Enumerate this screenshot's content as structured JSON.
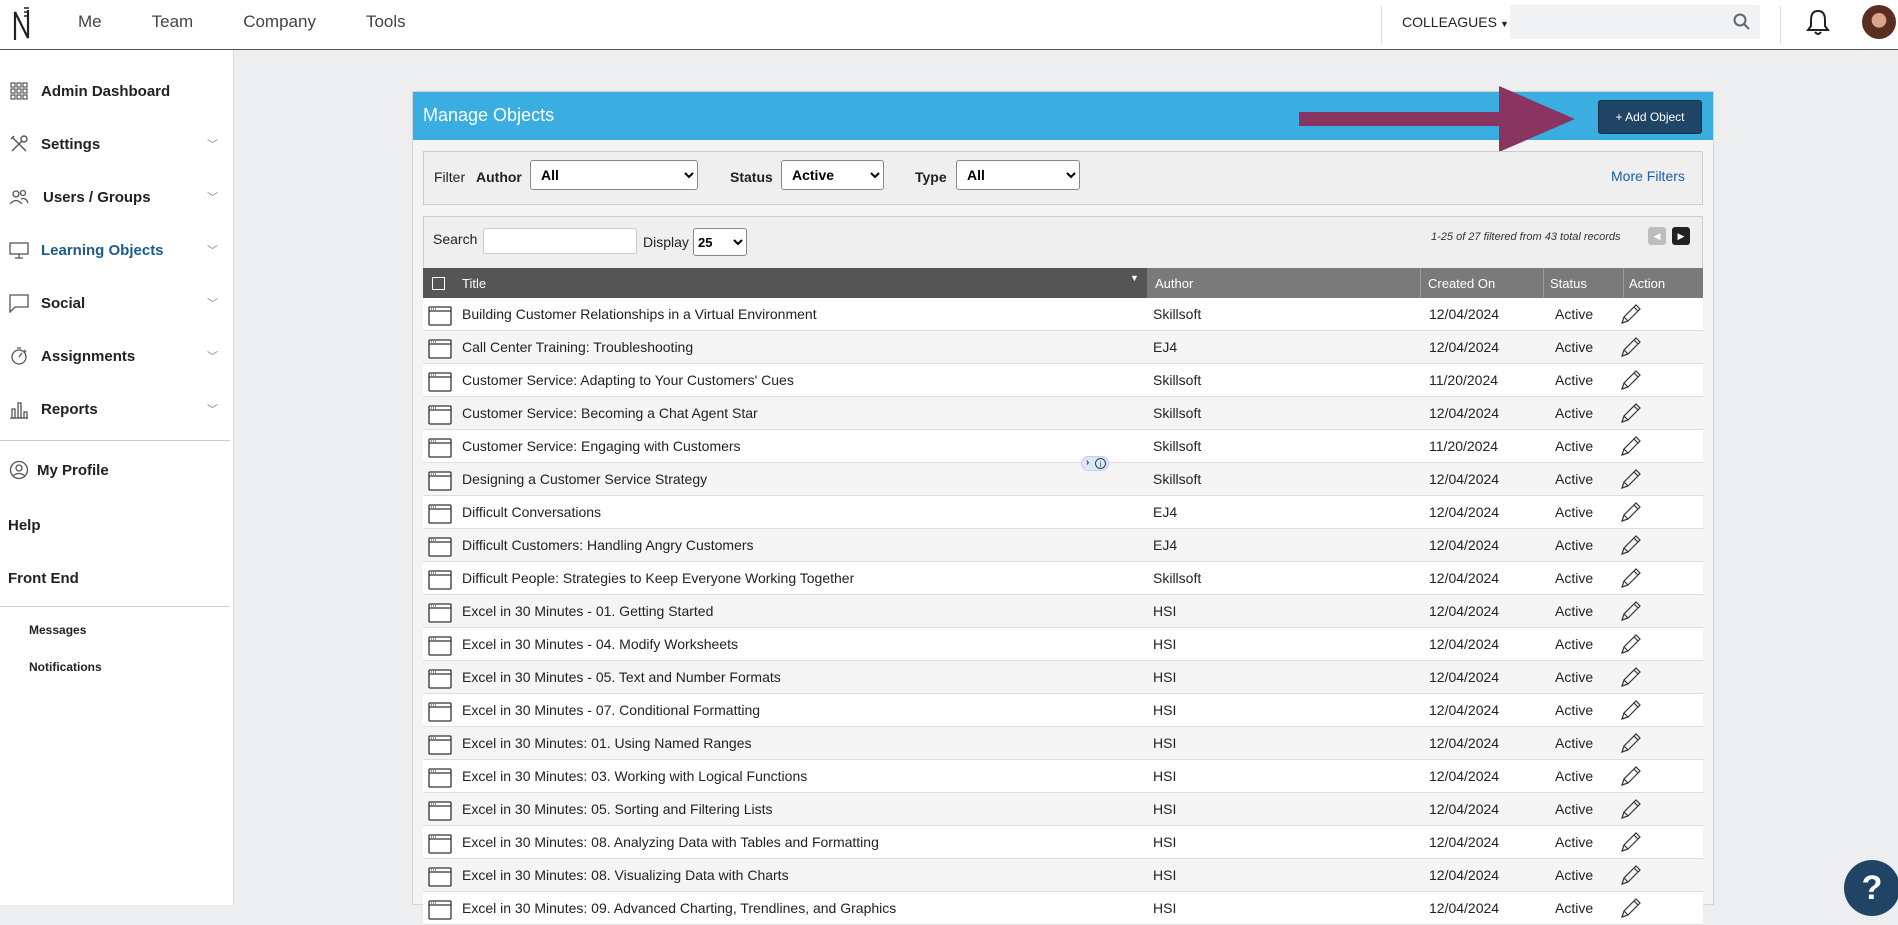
{
  "topnav": [
    "Me",
    "Team",
    "Company",
    "Tools"
  ],
  "colleagues_label": "COLLEAGUES",
  "sidebar": {
    "items": [
      {
        "label": "Admin Dashboard",
        "icon": "grid-icon",
        "chevron": false
      },
      {
        "label": "Settings",
        "icon": "tools-icon",
        "chevron": true
      },
      {
        "label": "Users / Groups",
        "icon": "users-icon",
        "chevron": true
      },
      {
        "label": "Learning Objects",
        "icon": "monitor-icon",
        "chevron": true,
        "active": true
      },
      {
        "label": "Social",
        "icon": "chat-icon",
        "chevron": true
      },
      {
        "label": "Assignments",
        "icon": "stopwatch-icon",
        "chevron": true
      },
      {
        "label": "Reports",
        "icon": "bar-chart-icon",
        "chevron": true
      }
    ],
    "my_profile": "My Profile",
    "help": "Help",
    "front_end": "Front End",
    "messages": "Messages",
    "notifications": "Notifications"
  },
  "panel": {
    "title": "Manage Objects",
    "add_button": "+ Add Object"
  },
  "filters": {
    "filter_label": "Filter",
    "author_label": "Author",
    "author_value": "All",
    "status_label": "Status",
    "status_value": "Active",
    "type_label": "Type",
    "type_value": "All",
    "more_filters": "More Filters"
  },
  "table_controls": {
    "search_label": "Search",
    "display_label": "Display",
    "display_value": "25",
    "records_text": "1-25 of 27 filtered from 43 total records"
  },
  "columns": [
    "Title",
    "Author",
    "Created On",
    "Status",
    "Action"
  ],
  "rows": [
    {
      "title": "Building Customer Relationships in a Virtual Environment",
      "author": "Skillsoft",
      "created": "12/04/2024",
      "status": "Active"
    },
    {
      "title": "Call Center Training: Troubleshooting",
      "author": "EJ4",
      "created": "12/04/2024",
      "status": "Active"
    },
    {
      "title": "Customer Service: Adapting to Your Customers' Cues",
      "author": "Skillsoft",
      "created": "11/20/2024",
      "status": "Active"
    },
    {
      "title": "Customer Service: Becoming a Chat Agent Star",
      "author": "Skillsoft",
      "created": "12/04/2024",
      "status": "Active"
    },
    {
      "title": "Customer Service: Engaging with Customers",
      "author": "Skillsoft",
      "created": "11/20/2024",
      "status": "Active"
    },
    {
      "title": "Designing a Customer Service Strategy",
      "author": "Skillsoft",
      "created": "12/04/2024",
      "status": "Active"
    },
    {
      "title": "Difficult Conversations",
      "author": "EJ4",
      "created": "12/04/2024",
      "status": "Active"
    },
    {
      "title": "Difficult Customers: Handling Angry Customers",
      "author": "EJ4",
      "created": "12/04/2024",
      "status": "Active"
    },
    {
      "title": "Difficult People: Strategies to Keep Everyone Working Together",
      "author": "Skillsoft",
      "created": "12/04/2024",
      "status": "Active"
    },
    {
      "title": "Excel in 30 Minutes - 01. Getting Started",
      "author": "HSI",
      "created": "12/04/2024",
      "status": "Active"
    },
    {
      "title": "Excel in 30 Minutes - 04. Modify Worksheets",
      "author": "HSI",
      "created": "12/04/2024",
      "status": "Active"
    },
    {
      "title": "Excel in 30 Minutes - 05. Text and Number Formats",
      "author": "HSI",
      "created": "12/04/2024",
      "status": "Active"
    },
    {
      "title": "Excel in 30 Minutes - 07. Conditional Formatting",
      "author": "HSI",
      "created": "12/04/2024",
      "status": "Active"
    },
    {
      "title": "Excel in 30 Minutes: 01. Using Named Ranges",
      "author": "HSI",
      "created": "12/04/2024",
      "status": "Active"
    },
    {
      "title": "Excel in 30 Minutes: 03. Working with Logical Functions",
      "author": "HSI",
      "created": "12/04/2024",
      "status": "Active"
    },
    {
      "title": "Excel in 30 Minutes: 05. Sorting and Filtering Lists",
      "author": "HSI",
      "created": "12/04/2024",
      "status": "Active"
    },
    {
      "title": "Excel in 30 Minutes: 08. Analyzing Data with Tables and Formatting",
      "author": "HSI",
      "created": "12/04/2024",
      "status": "Active"
    },
    {
      "title": "Excel in 30 Minutes: 08. Visualizing Data with Charts",
      "author": "HSI",
      "created": "12/04/2024",
      "status": "Active"
    },
    {
      "title": "Excel in 30 Minutes: 09. Advanced Charting, Trendlines, and Graphics",
      "author": "HSI",
      "created": "12/04/2024",
      "status": "Active"
    }
  ],
  "help_fab": "?",
  "colors": {
    "header_blue": "#3aaee0",
    "button_navy": "#1f4466",
    "arrow": "#8a3461",
    "link": "#1a5fa8"
  }
}
